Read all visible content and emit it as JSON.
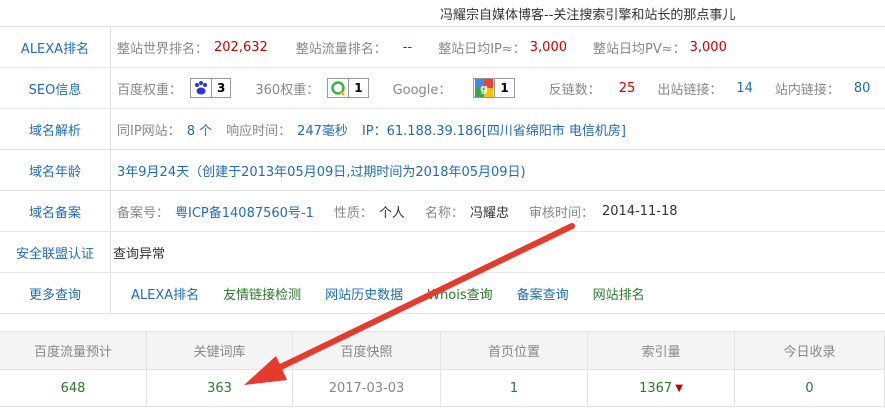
{
  "site_title": "冯耀宗自媒体博客--关注搜索引擎和站长的那点事儿",
  "alexa": {
    "head": "ALEXA排名",
    "world_rank_label": "整站世界排名：",
    "world_rank": "202,632",
    "traffic_rank_label": "整站流量排名：",
    "traffic_rank": "--",
    "daily_ip_label": "整站日均IP≈：",
    "daily_ip": "3,000",
    "daily_pv_label": "整站日均PV≈：",
    "daily_pv": "3,000"
  },
  "seo": {
    "head": "SEO信息",
    "baidu_label": "百度权重：",
    "baidu_value": "3",
    "s360_label": "360权重：",
    "s360_value": "1",
    "google_label": "Google：",
    "google_value": "1",
    "backlinks_label": "反链数：",
    "backlinks": "25",
    "outlinks_label": "出站链接：",
    "outlinks": "14",
    "inlinks_label": "站内链接：",
    "inlinks": "80"
  },
  "dns": {
    "head": "域名解析",
    "same_ip_label": "同IP网站：",
    "same_ip": "8 个",
    "response_label": "响应时间：",
    "response": "247毫秒",
    "ip_text": "IP：61.188.39.186[四川省绵阳市 电信机房]"
  },
  "age": {
    "head": "域名年龄",
    "text": "3年9月24天（创建于2013年05月09日,过期时间为2018年05月09日)"
  },
  "icp": {
    "head": "域名备案",
    "number_label": "备案号：",
    "number": "粤ICP备14087560号-1",
    "nature_label": "性质：",
    "nature": "个人",
    "name_label": "名称：",
    "name": "冯耀忠",
    "audit_label": "审核时间：",
    "audit": "2014-11-18"
  },
  "security": {
    "head": "安全联盟认证",
    "text": "查询异常"
  },
  "more": {
    "head": "更多查询",
    "links": [
      "ALEXA排名",
      "友情链接检测",
      "网站历史数据",
      "Whois查询",
      "备案查询",
      "网站排名"
    ]
  },
  "stats": {
    "headers": [
      "百度流量预计",
      "关键词库",
      "百度快照",
      "首页位置",
      "索引量",
      "今日收录"
    ],
    "values": [
      "648",
      "363",
      "2017-03-03",
      "1",
      "1367",
      "0"
    ],
    "index_trend": "down"
  }
}
